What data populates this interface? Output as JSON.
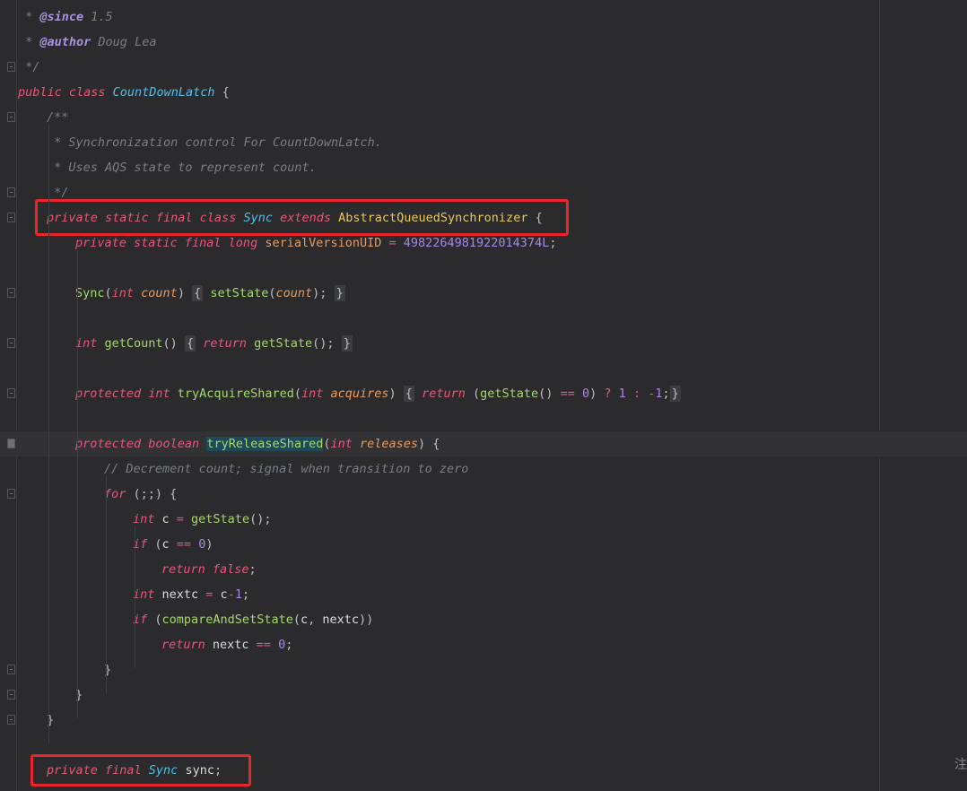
{
  "editor": {
    "lines": [
      {
        "id": "l1",
        "segments": [
          [
            "cm",
            " * "
          ],
          [
            "tag",
            "@since"
          ],
          [
            "cm",
            " 1.5"
          ]
        ]
      },
      {
        "id": "l2",
        "segments": [
          [
            "cm",
            " * "
          ],
          [
            "tag",
            "@author"
          ],
          [
            "cm",
            " Doug Lea"
          ]
        ]
      },
      {
        "id": "l3",
        "segments": [
          [
            "cm",
            " */"
          ]
        ]
      },
      {
        "id": "l4",
        "segments": [
          [
            "kw",
            "public class "
          ],
          [
            "cls",
            "CountDownLatch"
          ],
          [
            "pun",
            " {"
          ]
        ]
      },
      {
        "id": "l5",
        "segments": [
          [
            "cm",
            "/**"
          ]
        ]
      },
      {
        "id": "l6",
        "segments": [
          [
            "cm",
            " * Synchronization control For CountDownLatch."
          ]
        ]
      },
      {
        "id": "l7",
        "segments": [
          [
            "cm",
            " * Uses AQS state to represent count."
          ]
        ]
      },
      {
        "id": "l8",
        "segments": [
          [
            "cm",
            " */"
          ]
        ]
      },
      {
        "id": "l9",
        "segments": [
          [
            "kw",
            "private static final class "
          ],
          [
            "cls",
            "Sync"
          ],
          [
            "kw",
            " extends "
          ],
          [
            "cls2",
            "AbstractQueuedSynchronizer"
          ],
          [
            "pun",
            " {"
          ]
        ]
      },
      {
        "id": "l10",
        "segments": [
          [
            "kw",
            "private static final long "
          ],
          [
            "fld",
            "serialVersionUID"
          ],
          [
            "op",
            " = "
          ],
          [
            "num",
            "4982264981922014374L"
          ],
          [
            "pun",
            ";"
          ]
        ]
      },
      {
        "id": "l11",
        "segments": []
      },
      {
        "id": "l12",
        "segments": [
          [
            "fn",
            "Sync"
          ],
          [
            "pun",
            "("
          ],
          [
            "kw",
            "int "
          ],
          [
            "prm",
            "count"
          ],
          [
            "pun",
            ") "
          ],
          [
            "box",
            "{"
          ],
          [
            "pun",
            " "
          ],
          [
            "fn",
            "setState"
          ],
          [
            "pun",
            "("
          ],
          [
            "prm",
            "count"
          ],
          [
            "pun",
            ");"
          ],
          [
            "pun",
            " "
          ],
          [
            "box",
            "}"
          ]
        ]
      },
      {
        "id": "l13",
        "segments": []
      },
      {
        "id": "l14",
        "segments": [
          [
            "kw",
            "int "
          ],
          [
            "fn",
            "getCount"
          ],
          [
            "pun",
            "() "
          ],
          [
            "box",
            "{"
          ],
          [
            "pun",
            " "
          ],
          [
            "kw",
            "return "
          ],
          [
            "fn",
            "getState"
          ],
          [
            "pun",
            "();"
          ],
          [
            "pun",
            " "
          ],
          [
            "box",
            "}"
          ]
        ]
      },
      {
        "id": "l15",
        "segments": []
      },
      {
        "id": "l16",
        "segments": [
          [
            "kw",
            "protected int "
          ],
          [
            "fn",
            "tryAcquireShared"
          ],
          [
            "pun",
            "("
          ],
          [
            "kw",
            "int "
          ],
          [
            "prm",
            "acquires"
          ],
          [
            "pun",
            ") "
          ],
          [
            "box",
            "{"
          ],
          [
            "pun",
            " "
          ],
          [
            "kw",
            "return "
          ],
          [
            "pun",
            "("
          ],
          [
            "fn",
            "getState"
          ],
          [
            "pun",
            "() "
          ],
          [
            "op",
            "=="
          ],
          [
            "pun",
            " "
          ],
          [
            "num",
            "0"
          ],
          [
            "pun",
            ") "
          ],
          [
            "op",
            "?"
          ],
          [
            "pun",
            " "
          ],
          [
            "num",
            "1"
          ],
          [
            "pun",
            " "
          ],
          [
            "op",
            ":"
          ],
          [
            "pun",
            " "
          ],
          [
            "op",
            "-"
          ],
          [
            "num",
            "1"
          ],
          [
            "pun",
            ";"
          ],
          [
            "box",
            "}"
          ]
        ]
      },
      {
        "id": "l17",
        "segments": []
      },
      {
        "id": "l18",
        "segments": [
          [
            "kw",
            "protected boolean "
          ],
          [
            "sel",
            "tryReleaseShared"
          ],
          [
            "pun",
            "("
          ],
          [
            "kw",
            "int "
          ],
          [
            "prm",
            "releases"
          ],
          [
            "pun",
            ") {"
          ]
        ]
      },
      {
        "id": "l19",
        "segments": [
          [
            "cm",
            "// Decrement count; signal when transition to zero"
          ]
        ]
      },
      {
        "id": "l20",
        "segments": [
          [
            "kw",
            "for "
          ],
          [
            "pun",
            "(;;) {"
          ]
        ]
      },
      {
        "id": "l21",
        "segments": [
          [
            "kw",
            "int "
          ],
          [
            "plain",
            "c"
          ],
          [
            "op",
            " = "
          ],
          [
            "fn",
            "getState"
          ],
          [
            "pun",
            "();"
          ]
        ]
      },
      {
        "id": "l22",
        "segments": [
          [
            "kw",
            "if "
          ],
          [
            "pun",
            "("
          ],
          [
            "plain",
            "c"
          ],
          [
            "op",
            " == "
          ],
          [
            "num",
            "0"
          ],
          [
            "pun",
            ")"
          ]
        ]
      },
      {
        "id": "l23",
        "segments": [
          [
            "kw",
            "return false"
          ],
          [
            "pun",
            ";"
          ]
        ]
      },
      {
        "id": "l24",
        "segments": [
          [
            "kw",
            "int "
          ],
          [
            "plain",
            "nextc"
          ],
          [
            "op",
            " = "
          ],
          [
            "plain",
            "c"
          ],
          [
            "op",
            "-"
          ],
          [
            "num",
            "1"
          ],
          [
            "pun",
            ";"
          ]
        ]
      },
      {
        "id": "l25",
        "segments": [
          [
            "kw",
            "if "
          ],
          [
            "pun",
            "("
          ],
          [
            "fn",
            "compareAndSetState"
          ],
          [
            "pun",
            "("
          ],
          [
            "plain",
            "c"
          ],
          [
            "pun",
            ", "
          ],
          [
            "plain",
            "nextc"
          ],
          [
            "pun",
            "))"
          ]
        ]
      },
      {
        "id": "l26",
        "segments": [
          [
            "kw",
            "return "
          ],
          [
            "plain",
            "nextc"
          ],
          [
            "op",
            " == "
          ],
          [
            "num",
            "0"
          ],
          [
            "pun",
            ";"
          ]
        ]
      },
      {
        "id": "l27",
        "segments": [
          [
            "pun",
            "}"
          ]
        ]
      },
      {
        "id": "l28",
        "segments": [
          [
            "pun",
            "}"
          ]
        ]
      },
      {
        "id": "l29",
        "segments": [
          [
            "pun",
            "}"
          ]
        ]
      },
      {
        "id": "l30",
        "segments": []
      },
      {
        "id": "l31",
        "segments": [
          [
            "kw",
            "private final "
          ],
          [
            "cls",
            "Sync"
          ],
          [
            "plain",
            " sync"
          ],
          [
            "pun",
            ";"
          ]
        ]
      }
    ],
    "edge_text": "注"
  },
  "colors": {
    "background": "#2b2b2d",
    "highlight_line": "#323235",
    "annotation_box": "#e8262b",
    "selection": "#1b4b5a"
  }
}
